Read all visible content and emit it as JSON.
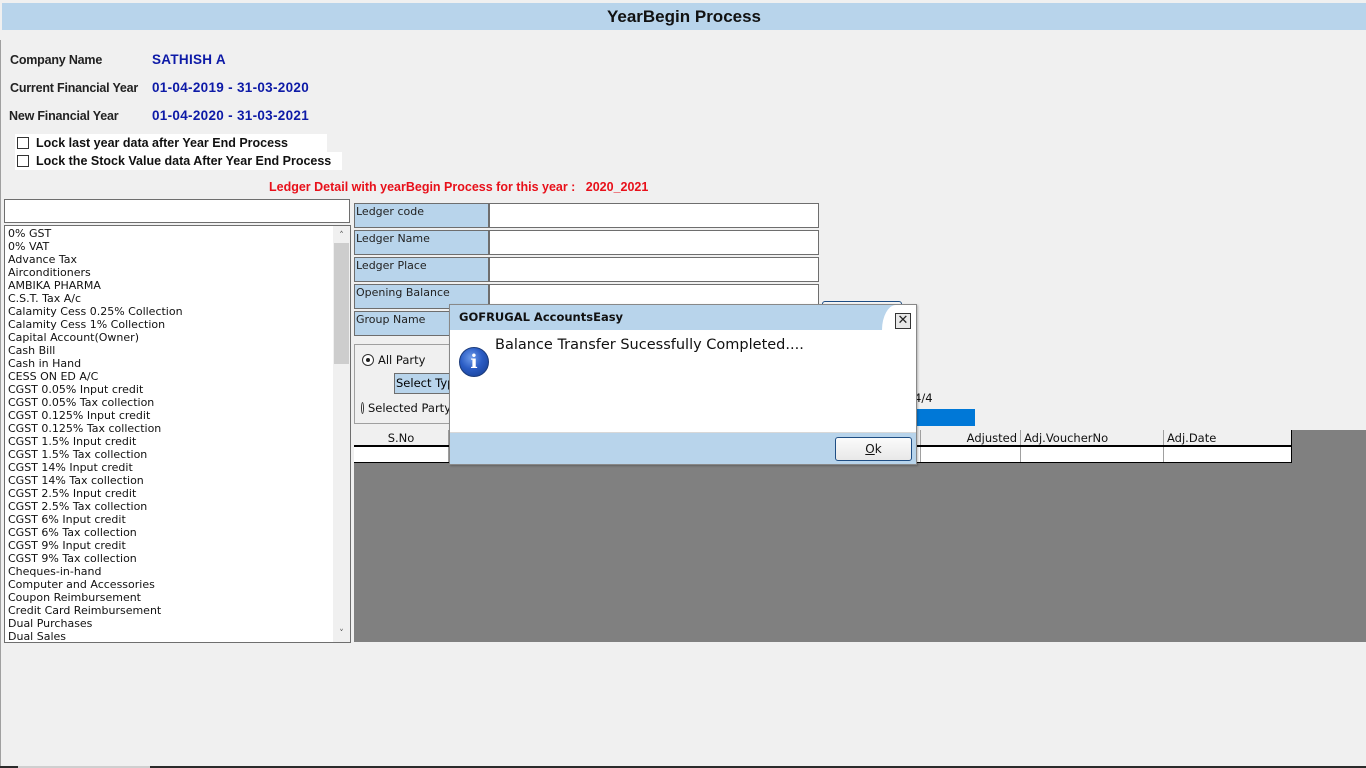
{
  "window": {
    "title": "YearBegin Process"
  },
  "company_info": {
    "company_name_label": "Company Name",
    "company_name_value": "SATHISH A",
    "current_fy_label": "Current Financial Year",
    "current_fy_value": "01-04-2019 - 31-03-2020",
    "new_fy_label": "New Financial Year",
    "new_fy_value": "01-04-2020 - 31-03-2021"
  },
  "options": {
    "lock_last_year": {
      "label": "Lock last year data after Year End Process",
      "checked": false
    },
    "lock_stock_value": {
      "label": "Lock the Stock Value data After Year End Process",
      "checked": false
    }
  },
  "ledger_heading": "Ledger Detail with yearBegin Process for this year :   2020_2021",
  "ledger_search": {
    "value": "",
    "placeholder": ""
  },
  "ledger_list": [
    "0% GST",
    "0% VAT",
    "Advance Tax",
    "Airconditioners",
    "AMBIKA PHARMA",
    "C.S.T. Tax A/c",
    "Calamity Cess 0.25% Collection",
    "Calamity Cess 1% Collection",
    "Capital Account(Owner)",
    "Cash Bill",
    "Cash in Hand",
    "CESS ON ED A/C",
    "CGST 0.05% Input credit",
    "CGST 0.05% Tax collection",
    "CGST 0.125% Input credit",
    "CGST 0.125% Tax collection",
    "CGST 1.5% Input credit",
    "CGST 1.5% Tax collection",
    "CGST 14% Input credit",
    "CGST 14% Tax collection",
    "CGST 2.5% Input credit",
    "CGST 2.5% Tax collection",
    "CGST 6% Input credit",
    "CGST 6% Tax collection",
    "CGST 9% Input credit",
    "CGST 9% Tax collection",
    "Cheques-in-hand",
    "Computer and Accessories",
    "Coupon Reimbursement",
    "Credit Card Reimbursement",
    "Dual Purchases",
    "Dual Sales"
  ],
  "ledger_fields": [
    {
      "label": "Ledger code",
      "value": ""
    },
    {
      "label": "Ledger Name",
      "value": ""
    },
    {
      "label": "Ledger Place",
      "value": ""
    },
    {
      "label": "Opening Balance",
      "value": ""
    },
    {
      "label": "Group Name",
      "value": ""
    }
  ],
  "party_filter": {
    "all_party_label": "All Party",
    "selected_party_label": "Selected Party",
    "selected": "All Party",
    "select_type_label": "Select Type"
  },
  "progress": {
    "text": "4/4",
    "percent": 100
  },
  "grid": {
    "columns": [
      "S.No",
      "",
      "",
      "",
      "",
      "",
      "Adjusted",
      "Adj.VoucherNo",
      "Adj.Date"
    ],
    "visible_columns": {
      "sno": "S.No",
      "adjusted": "Adjusted",
      "adj_voucher_no": "Adj.VoucherNo",
      "adj_date": "Adj.Date"
    },
    "rows": []
  },
  "dialog": {
    "title": "GOFRUGAL AccountsEasy",
    "message": "Balance Transfer Sucessfully Completed....",
    "icon": "info-icon",
    "ok_label_prefix": "O",
    "ok_label_rest": "k",
    "close_glyph": "✕"
  },
  "colors": {
    "header_bg": "#b8d4eb",
    "value_blue": "#0d1aa7",
    "heading_red": "#e8101a",
    "progress_blue": "#0078d7",
    "grid_bg": "#808080"
  }
}
